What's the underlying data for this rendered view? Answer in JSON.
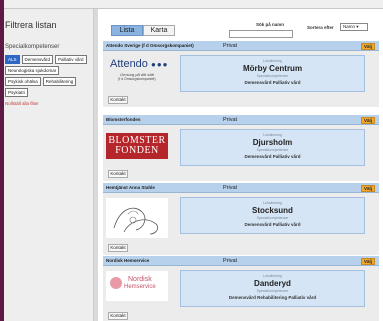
{
  "sidebar": {
    "title": "Filtrera listan",
    "specialties_label": "Specialkompetenser",
    "tags": [
      {
        "label": "ALS",
        "active": true
      },
      {
        "label": "Demensvård",
        "active": false
      },
      {
        "label": "Palliativ vård",
        "active": false
      },
      {
        "label": "Neurologiska sjukdomar",
        "active": false
      },
      {
        "label": "Psykisk ohälsa",
        "active": false
      },
      {
        "label": "Rehabilitering",
        "active": false
      },
      {
        "label": "Psykiatri",
        "active": false
      }
    ],
    "clear_filters": "Nollställ alla filter"
  },
  "toolbar": {
    "list_label": "Lista",
    "map_label": "Karta",
    "search_label": "Sök på namn",
    "search_value": "",
    "sort_label": "Sortera efter",
    "sort_value": "Namn ▾"
  },
  "cards": [
    {
      "name": "Attendo Sverige (f d Omsorgskompaniet)",
      "type": "Privat",
      "choose_label": "Välj",
      "location_label": "Lokalisering",
      "city": "Mörby Centrum",
      "specialties_label": "Specialkompetenser",
      "specialties": "Demensvård   Palliativ vård",
      "contact_label": "Kontakt",
      "logo": {
        "line1": "Attendo",
        "line2": "Omsorg på ditt sätt",
        "line3": "(f d Omsorgskompaniet)"
      }
    },
    {
      "name": "Blomsterfonden",
      "type": "Privat",
      "choose_label": "Välj",
      "location_label": "Lokalisering",
      "city": "Djursholm",
      "specialties_label": "Specialkompetenser",
      "specialties": "Demensvård   Palliativ vård",
      "contact_label": "Kontakt",
      "logo": {
        "line1": "BLOMSTER",
        "line2": "FONDEN"
      }
    },
    {
      "name": "Hemtjänst Anna Stahle",
      "type": "Privat",
      "choose_label": "Välj",
      "location_label": "Lokalisering",
      "city": "Stocksund",
      "specialties_label": "Specialkompetenser",
      "specialties": "Demensvård   Palliativ vård",
      "contact_label": "Kontakt"
    },
    {
      "name": "Nordisk Hemservice",
      "type": "Privat",
      "choose_label": "Välj",
      "location_label": "Lokalisering",
      "city": "Danderyd",
      "specialties_label": "Specialkompetenser",
      "specialties": "Demensvård   Rehabilitering   Palliativ vård",
      "contact_label": "Kontakt",
      "logo": {
        "line1": "Nordisk",
        "line2": "Hemservice"
      }
    }
  ],
  "colors": {
    "header_blue": "#b7d1ec",
    "info_blue": "#d6e5f5",
    "choose_orange": "#f0a92e",
    "active_tag": "#2f68c4",
    "brand_red": "#b5262b",
    "frame_purple": "#5c1a45"
  }
}
